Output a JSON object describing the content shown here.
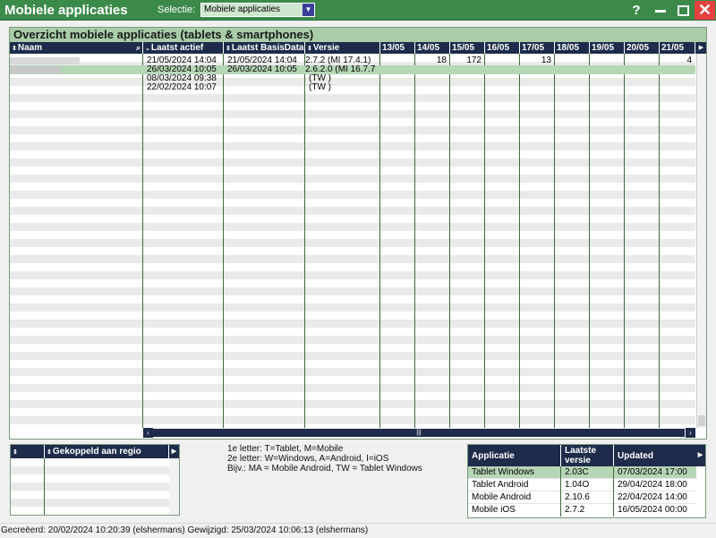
{
  "window": {
    "title": "Mobiele applicaties",
    "selectie_label": "Selectie:",
    "selectie_value": "Mobiele applicaties",
    "help": "?",
    "close": "✕"
  },
  "grid": {
    "title": "Overzicht mobiele applicaties (tablets & smartphones)",
    "columns": [
      "Naam",
      "Laatst actief",
      "Laatst BasisData",
      "Versie",
      "13/05",
      "14/05",
      "15/05",
      "16/05",
      "17/05",
      "18/05",
      "19/05",
      "20/05",
      "21/05"
    ],
    "rows": [
      {
        "naam": "",
        "laatst_actief": "21/05/2024 14:04",
        "basisdata": "21/05/2024 14:04",
        "versie": "2.7.2 (MI 17.4.1)",
        "d14": "18",
        "d15": "172",
        "d17": "13",
        "d21": "4"
      },
      {
        "naam": "",
        "laatst_actief": "26/03/2024 10:05",
        "basisdata": "26/03/2024 10:05",
        "versie": "2.6.2.0 (MI 16.7.7",
        "d14": "",
        "d15": "",
        "d17": "",
        "d21": ""
      },
      {
        "naam": "",
        "laatst_actief": "08/03/2024 09:38",
        "basisdata": "",
        "versie": "(TW )",
        "d14": "",
        "d15": "",
        "d17": "",
        "d21": ""
      },
      {
        "naam": "",
        "laatst_actief": "22/02/2024 10:07",
        "basisdata": "",
        "versie": "(TW )",
        "d14": "",
        "d15": "",
        "d17": "",
        "d21": ""
      }
    ]
  },
  "region": {
    "header": "Gekoppeld aan regio"
  },
  "legend": {
    "line1": "1e letter: T=Tablet, M=Mobile",
    "line2": "2e letter: W=Windows, A=Android, I=iOS",
    "line3": "Bijv.: MA = Mobile Android, TW = Tablet Windows"
  },
  "apps": {
    "headers": {
      "app": "Applicatie",
      "versie": "Laatste versie",
      "updated": "Updated"
    },
    "rows": [
      {
        "app": "Tablet Windows",
        "versie": "2.03C",
        "updated": "07/03/2024 17:00"
      },
      {
        "app": "Tablet Android",
        "versie": "1.04O",
        "updated": "29/04/2024 18:00"
      },
      {
        "app": "Mobile Android",
        "versie": "2.10.6",
        "updated": "22/04/2024 14:00"
      },
      {
        "app": "Mobile iOS",
        "versie": "2.7.2",
        "updated": "16/05/2024 00:00"
      }
    ]
  },
  "status": "Gecreëerd: 20/02/2024 10:20:39 (elshermans) Gewijzigd: 25/03/2024 10:06:13 (elshermans)",
  "colors": {
    "titlebar": "#3b8a4a",
    "header_navy": "#1e2b4a",
    "selected_row": "#b6d6b6",
    "close_red": "#e64141"
  }
}
